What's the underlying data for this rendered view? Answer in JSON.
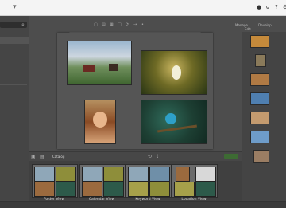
{
  "titlebar": {
    "icon_a": "▴",
    "icon_b": "▴"
  },
  "header": {
    "menu_tabs": [
      "Manage",
      "Develop",
      "Edit"
    ],
    "tools": [
      "▢",
      "▤",
      "▦",
      "□",
      "⟳",
      "→",
      "•"
    ]
  },
  "gallery": {
    "type": "photo-grid"
  },
  "bottom": {
    "catalog_label": "Catalog",
    "views": [
      {
        "label": "Folder View"
      },
      {
        "label": "Calendar View"
      },
      {
        "label": "Keyword View"
      },
      {
        "label": "Location View"
      }
    ]
  },
  "colors": {
    "accent": "#5ab443"
  }
}
